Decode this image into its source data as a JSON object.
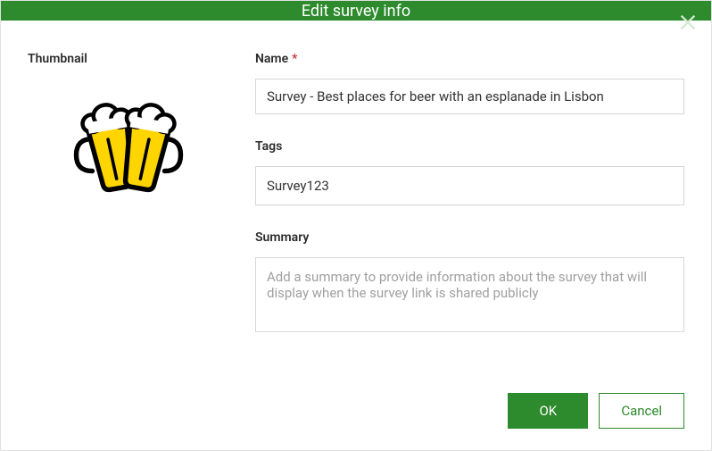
{
  "dialog": {
    "title": "Edit survey info"
  },
  "labels": {
    "thumbnail": "Thumbnail",
    "name": "Name",
    "tags": "Tags",
    "summary": "Summary"
  },
  "fields": {
    "name_value": "Survey - Best places for beer with an esplanade in Lisbon",
    "tags_value": "Survey123",
    "summary_value": "",
    "summary_placeholder": "Add a summary to provide information about the survey that will display when the survey link is shared publicly"
  },
  "buttons": {
    "ok": "OK",
    "cancel": "Cancel"
  }
}
